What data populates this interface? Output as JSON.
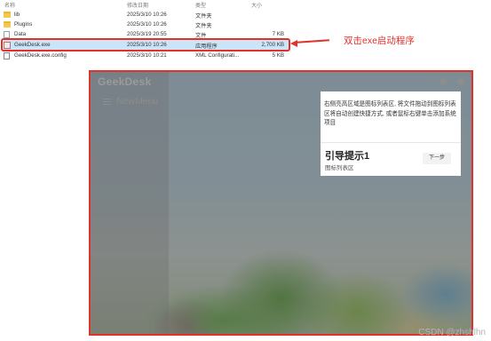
{
  "explorer": {
    "columns": {
      "name": "名称",
      "date": "修改日期",
      "type": "类型",
      "size": "大小"
    },
    "rows": [
      {
        "name": "lib",
        "date": "2025/3/10 10:26",
        "type": "文件夹",
        "size": "",
        "icon": "folder-icon"
      },
      {
        "name": "Plugins",
        "date": "2025/3/10 10:26",
        "type": "文件夹",
        "size": "",
        "icon": "folder-icon"
      },
      {
        "name": "Data",
        "date": "2025/3/19 20:55",
        "type": "文件",
        "size": "7 KB",
        "icon": "file-icon"
      },
      {
        "name": "GeekDesk.exe",
        "date": "2025/3/10 10:26",
        "type": "应用程序",
        "size": "2,700 KB",
        "icon": "exe-icon"
      },
      {
        "name": "GeekDesk.exe.config",
        "date": "2025/3/10 10:21",
        "type": "XML Configurati...",
        "size": "5 KB",
        "icon": "config-icon"
      }
    ]
  },
  "annotation": {
    "text": "双击exe启动程序",
    "color": "#e0312b"
  },
  "app": {
    "title": "GeekDesk",
    "menu_label": "NewMenu",
    "tip_text": "右侧亮高区域是图标列表区, 将文件拖动到图标列表区将自动创建快捷方式, 或者鼠标右键单击添加系统项目",
    "guide": {
      "title": "引导提示1",
      "subtitle": "图标列表区",
      "next_label": "下一步"
    }
  },
  "watermark": "CSDN @zhshlhn"
}
